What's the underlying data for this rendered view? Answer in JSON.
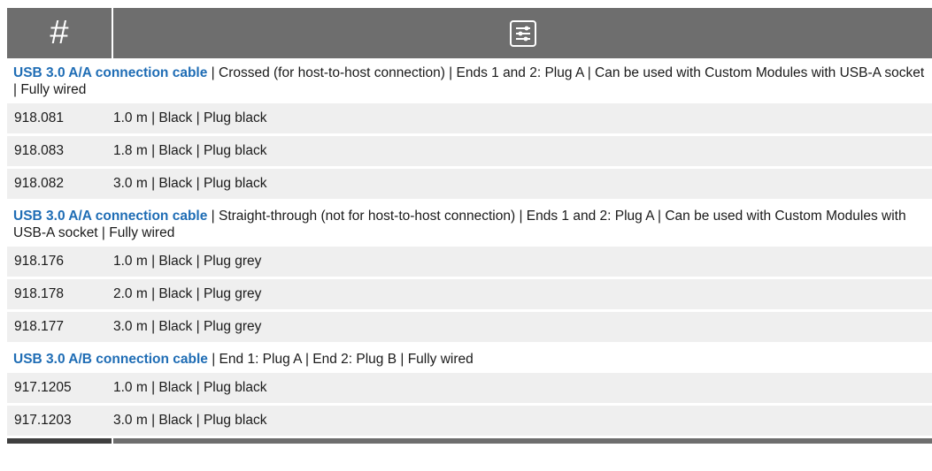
{
  "header": {
    "num_label": "#",
    "filter_icon": "sliders-icon"
  },
  "colors": {
    "header_bg": "#6e6e6e",
    "title_blue": "#1f6db5",
    "row_shade": "#efefef"
  },
  "groups": [
    {
      "title": "USB 3.0 A/A connection cable",
      "details": " | Crossed (for host-to-host connection) | Ends 1 and 2: Plug A | Can be used with Custom Modules with USB-A socket | Fully wired",
      "items": [
        {
          "number": "918.081",
          "spec": "1.0 m | Black | Plug black"
        },
        {
          "number": "918.083",
          "spec": "1.8 m | Black | Plug black"
        },
        {
          "number": "918.082",
          "spec": "3.0 m | Black | Plug black"
        }
      ]
    },
    {
      "title": "USB 3.0 A/A connection cable",
      "details": " | Straight-through (not for host-to-host connection) | Ends 1 and 2: Plug A | Can be used with Custom Modules with USB-A socket | Fully wired",
      "items": [
        {
          "number": "918.176",
          "spec": "1.0 m | Black | Plug grey"
        },
        {
          "number": "918.178",
          "spec": "2.0 m | Black | Plug grey"
        },
        {
          "number": "918.177",
          "spec": "3.0 m | Black | Plug grey"
        }
      ]
    },
    {
      "title": "USB 3.0 A/B connection cable",
      "details": " | End 1: Plug A | End 2: Plug B | Fully wired",
      "items": [
        {
          "number": "917.1205",
          "spec": "1.0 m | Black | Plug black"
        },
        {
          "number": "917.1203",
          "spec": "3.0 m | Black | Plug black"
        }
      ]
    }
  ]
}
